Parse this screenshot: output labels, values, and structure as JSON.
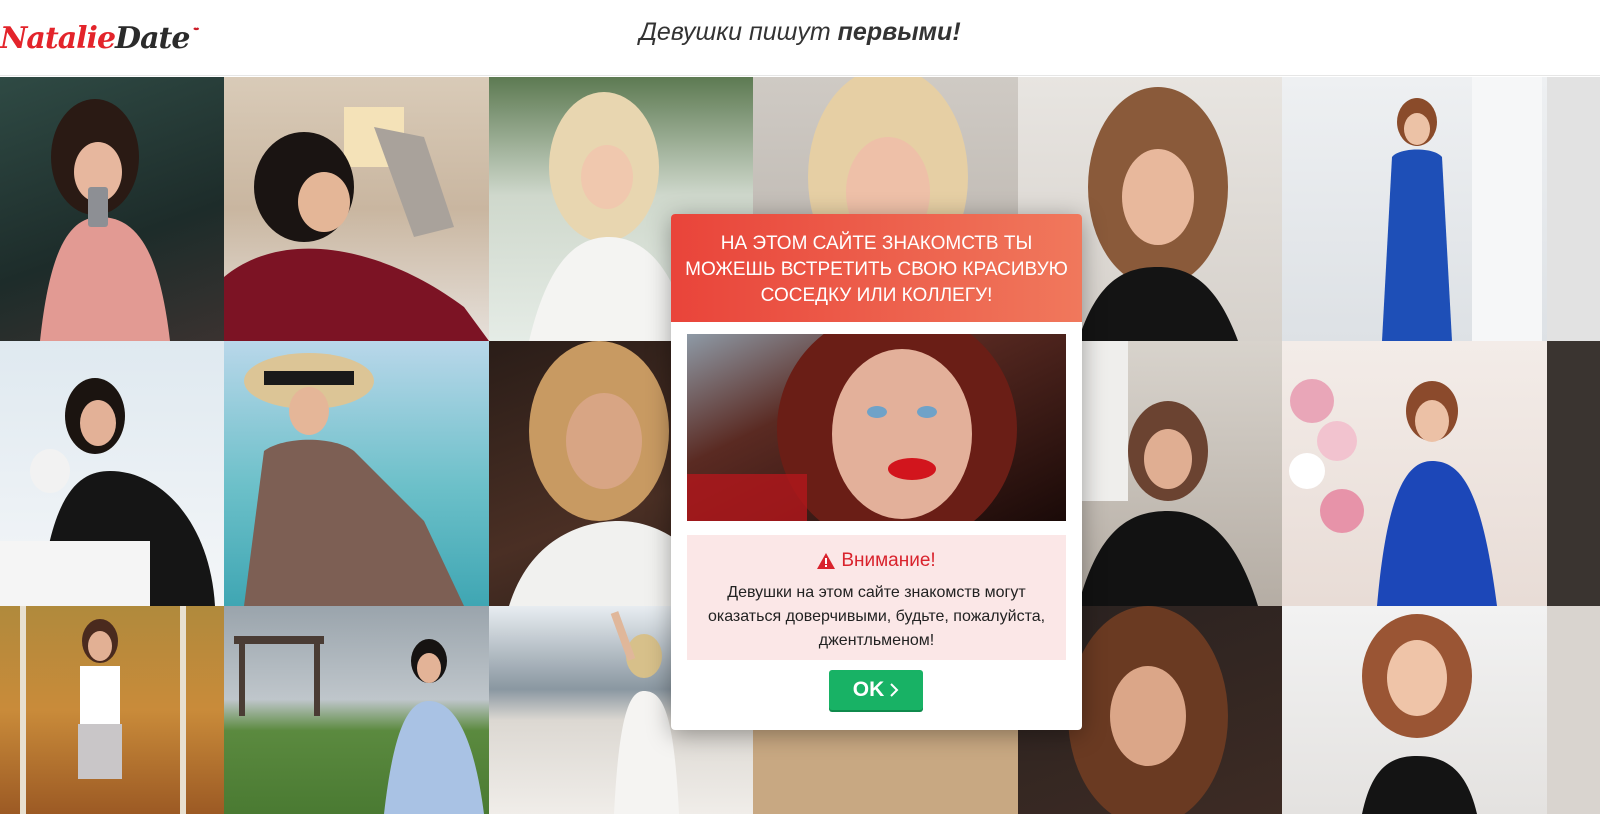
{
  "header": {
    "logo_first": "Natalie",
    "logo_second": "Date",
    "tagline_plain": "Девушки пишут ",
    "tagline_bold": "первыми!"
  },
  "modal": {
    "title": "НА ЭТОМ САЙТЕ ЗНАКОМСТВ ТЫ МОЖЕШЬ ВСТРЕТИТЬ СВОЮ КРАСИВУЮ СОСЕДКУ ИЛИ КОЛЛЕГУ!",
    "warning_title": "Внимание!",
    "warning_text": "Девушки на этом сайте знакомств могут оказаться доверчивыми, будьте, пожалуйста, джентльменом!",
    "ok_label": "OK",
    "header_color": "#e9443a",
    "ok_color": "#18b265",
    "warning_icon": "warning-triangle-icon"
  }
}
